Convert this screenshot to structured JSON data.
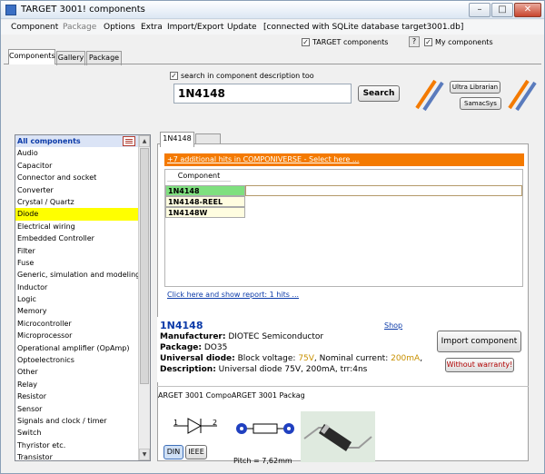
{
  "window": {
    "title": "TARGET 3001! components",
    "min": "–",
    "max": "□",
    "close": "✕"
  },
  "menu": [
    "Component",
    "Package",
    "Options",
    "Extra",
    "Import/Export",
    "Update"
  ],
  "status": "[connected with SQLite database target3001.db]",
  "checks": {
    "target_components": "TARGET components",
    "help": "?",
    "my_components": "My components",
    "search_desc": "search in component description too",
    "mark": "✓"
  },
  "tabs": [
    "Components",
    "Gallery",
    "Package"
  ],
  "search": {
    "value": "1N4148",
    "button": "Search"
  },
  "vendors": {
    "ultra": "Ultra Librarian",
    "samac": "SamacSys"
  },
  "categories": [
    "All components",
    "Audio",
    "Capacitor",
    "Connector and socket",
    "Converter",
    "Crystal / Quartz",
    "Diode",
    "Electrical wiring",
    "Embedded Controller",
    "Filter",
    "Fuse",
    "Generic, simulation and modeling",
    "Inductor",
    "Logic",
    "Memory",
    "Microcontroller",
    "Microprocessor",
    "Operational amplifier (OpAmp)",
    "Optoelectronics",
    "Other",
    "Relay",
    "Resistor",
    "Sensor",
    "Signals and clock / timer",
    "Switch",
    "Thyristor etc.",
    "Transistor"
  ],
  "selected_category": "Diode",
  "result_tab": "1N4148",
  "hits_banner": "+7 additional hits in COMPONIVERSE - Select here ...",
  "column_header": "Component name",
  "results": [
    "1N4148",
    "1N4148-REEL",
    "1N4148W"
  ],
  "report_link": "Click here and show report: 1 hits ...",
  "detail": {
    "name": "1N4148",
    "shop": "Shop",
    "manufacturer_label": "Manufacturer:",
    "manufacturer": " DIOTEC Semiconductor",
    "package_label": "Package:",
    "package": " DO35",
    "type_label": "Universal diode:",
    "voltage_pre": " Block voltage: ",
    "voltage": "75V",
    "current_pre": ", Nominal current: ",
    "current": "200mA",
    "current_post": ",",
    "desc_label": "Description:",
    "desc": " Universal diode  75V, 200mA, trr:4ns"
  },
  "import_button": "Import component",
  "warranty_button": "Without warranty!",
  "lib_tabs": "ARGET 3001 CompoARGET 3001 Packag",
  "symbol_pins": {
    "p1": "1",
    "p2": "2"
  },
  "din": "DIN",
  "ieee": "IEEE",
  "pitch": "Pitch = 7,62mm",
  "colors": {
    "accent": "#f47a00",
    "link": "#0b3aa8",
    "selected": "#ffff00",
    "highlight": "#c89000"
  }
}
